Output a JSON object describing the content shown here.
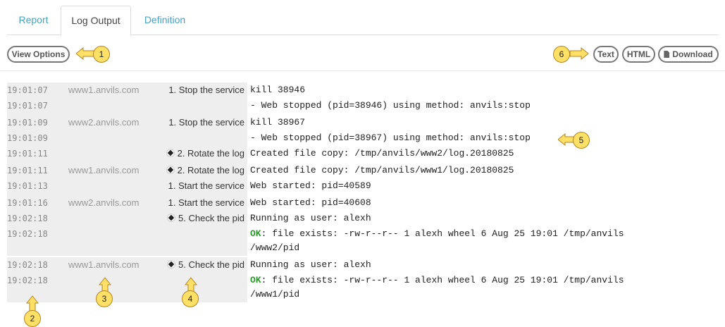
{
  "tabs": [
    {
      "label": "Report"
    },
    {
      "label": "Log Output"
    },
    {
      "label": "Definition"
    }
  ],
  "toolbar": {
    "view_options": "View Options",
    "text": "Text",
    "html": "HTML",
    "download": "Download"
  },
  "callouts": [
    "1",
    "2",
    "3",
    "4",
    "5",
    "6"
  ],
  "log": [
    {
      "time": "19:01:07",
      "host": "www1.anvils.com",
      "step": "1. Stop the service",
      "diamond": false,
      "msg": "kill 38946"
    },
    {
      "time": "19:01:07",
      "host": "",
      "step": "",
      "diamond": false,
      "msg": "- Web stopped (pid=38946) using method: anvils:stop"
    },
    {
      "time": "19:01:09",
      "host": "www2.anvils.com",
      "step": "1. Stop the service",
      "diamond": false,
      "msg": "kill 38967"
    },
    {
      "time": "19:01:09",
      "host": "",
      "step": "",
      "diamond": false,
      "msg": "- Web stopped (pid=38967) using method: anvils:stop"
    },
    {
      "time": "19:01:11",
      "host": "",
      "step": "2. Rotate the log",
      "diamond": true,
      "msg": "Created file copy: /tmp/anvils/www2/log.20180825"
    },
    {
      "time": "19:01:11",
      "host": "www1.anvils.com",
      "step": "2. Rotate the log",
      "diamond": true,
      "msg": "Created file copy: /tmp/anvils/www1/log.20180825"
    },
    {
      "time": "19:01:13",
      "host": "",
      "step": "1. Start the service",
      "diamond": false,
      "msg": "Web started: pid=40589"
    },
    {
      "time": "19:01:16",
      "host": "www2.anvils.com",
      "step": "1. Start the service",
      "diamond": false,
      "msg": "Web started: pid=40608"
    },
    {
      "time": "19:02:18",
      "host": "",
      "step": "5. Check the pid",
      "diamond": true,
      "msg": "Running as user: alexh"
    },
    {
      "time": "19:02:18",
      "host": "",
      "step": "",
      "diamond": false,
      "ok": "OK",
      "msg": ": file exists: -rw-r--r--  1 alexh  wheel  6 Aug 25 19:01 /tmp/anvils",
      "msg2": "/www2/pid"
    },
    {
      "time": "19:02:18",
      "host": "www1.anvils.com",
      "step": "5. Check the pid",
      "diamond": true,
      "msg": "Running as user: alexh"
    },
    {
      "time": "19:02:18",
      "host": "",
      "step": "",
      "diamond": false,
      "ok": "OK",
      "msg": ": file exists: -rw-r--r--  1 alexh  wheel  6 Aug 25 19:01 /tmp/anvils",
      "msg2": "/www1/pid"
    }
  ]
}
